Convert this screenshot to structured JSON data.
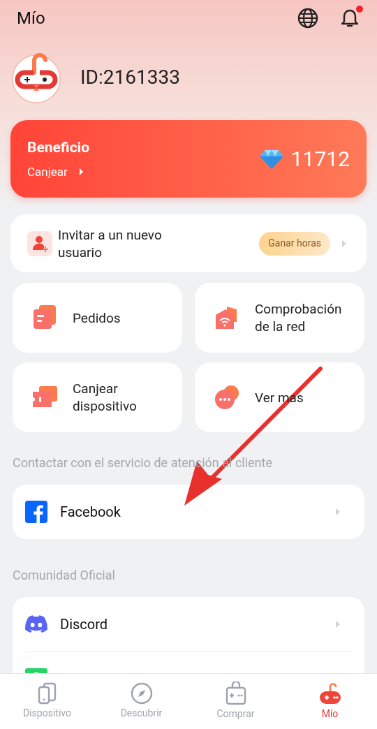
{
  "header": {
    "title": "Mío",
    "notification_dot": true
  },
  "profile": {
    "id": "ID:2161333"
  },
  "benefit": {
    "title": "Beneficio",
    "link": "Canjear",
    "amount": "11712"
  },
  "invite": {
    "label": "Invitar a un nuevo usuario",
    "badge": "Ganar horas"
  },
  "tiles": [
    {
      "kind": "orders",
      "label": "Pedidos"
    },
    {
      "kind": "network",
      "label": "Comprobación de la red"
    },
    {
      "kind": "device",
      "label": "Canjear dispositivo"
    },
    {
      "kind": "more",
      "label": "Ver mas"
    }
  ],
  "contact": {
    "heading": "Contactar con el servicio de atención al cliente",
    "items": [
      {
        "kind": "facebook",
        "label": "Facebook"
      }
    ]
  },
  "community": {
    "heading": "Comunidad Oficial",
    "items": [
      {
        "kind": "discord",
        "label": "Discord"
      },
      {
        "kind": "whatsapp"
      }
    ]
  },
  "annotation": {
    "kind": "arrow"
  },
  "tabs": [
    {
      "kind": "device",
      "label": "Dispositivo",
      "selected": false
    },
    {
      "kind": "discover",
      "label": "Descubrir",
      "selected": false
    },
    {
      "kind": "shop",
      "label": "Comprar",
      "selected": false
    },
    {
      "kind": "mine",
      "label": "Mío",
      "selected": true
    }
  ]
}
